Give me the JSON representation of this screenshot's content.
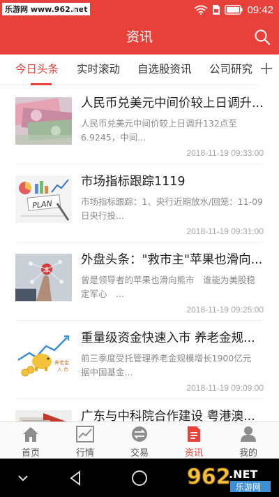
{
  "statusbar": {
    "watermark": "乐游网 www.962.net",
    "time": "09:42",
    "icons": [
      "image-icon",
      "wifi-icon",
      "sim-icon",
      "battery-icon"
    ]
  },
  "header": {
    "title": "资讯",
    "search_icon": "search-icon"
  },
  "tabs": [
    {
      "label": "今日头条",
      "active": true
    },
    {
      "label": "实时滚动",
      "active": false
    },
    {
      "label": "自选股资讯",
      "active": false
    },
    {
      "label": "公司研究",
      "active": false
    }
  ],
  "tabs_more_icon": "plus-icon",
  "news": [
    {
      "title": "人民币兑美元中间价较上日调升...",
      "summary": "人民币兑美元中间价较上日调升132点至6.9245，中间...",
      "time": "2018-11-19 09:33:00",
      "thumb": "currency-banknotes"
    },
    {
      "title": "市场指标跟踪1119",
      "summary": "市场指标跟踪：1、央行近期放水/回笼：11-09日央行投...",
      "time": "2018-11-19 09:31:00",
      "thumb": "plan-charts"
    },
    {
      "title": "外盘头条：\"救市主\"苹果也滑向...",
      "summary": "曾是领导者的苹果也滑向熊市　谁能为美股稳定军心　...",
      "time": "2018-11-19 09:25:00",
      "thumb": "finance-touch"
    },
    {
      "title": "重量级资金快速入市 养老金规...",
      "summary": "前三季度受托管理养老金规模增长1900亿元　　据中国基金...",
      "time": "2018-11-19 09:09:00",
      "thumb": "pension-piggy"
    },
    {
      "title": "广东与中科院合作建设 粤港澳...",
      "summary": "",
      "time": "",
      "thumb": "research-building"
    }
  ],
  "thumb_labels": {
    "plan": "PLAN",
    "pension": "养老金",
    "pension_sub": "入 市"
  },
  "bottom_nav": [
    {
      "label": "首页",
      "icon": "home-icon",
      "active": false
    },
    {
      "label": "行情",
      "icon": "chart-icon",
      "active": false
    },
    {
      "label": "交易",
      "icon": "exchange-icon",
      "active": false
    },
    {
      "label": "资讯",
      "icon": "news-icon",
      "active": true
    },
    {
      "label": "我的",
      "icon": "user-icon",
      "active": false
    }
  ],
  "watermark_logo": {
    "main": "962",
    "suffix": ".NET",
    "sub": "乐游网"
  },
  "colors": {
    "accent": "#e8413a",
    "text": "#1e1e1e",
    "muted": "#8a8a8a"
  }
}
